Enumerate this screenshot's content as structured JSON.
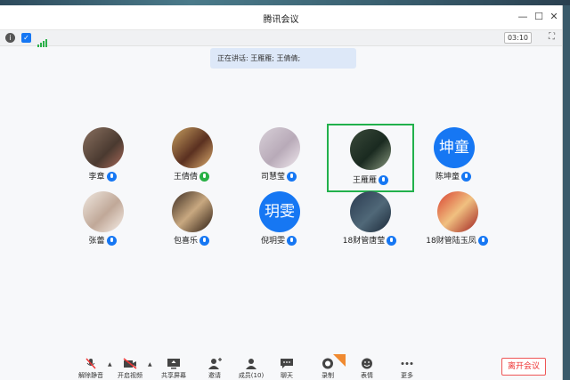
{
  "window": {
    "title": "腾讯会议"
  },
  "status": {
    "timer": "03:10"
  },
  "speaking": {
    "text": "正在讲话: 王雁雁; 王倩倩;"
  },
  "participants": [
    {
      "name": "李章"
    },
    {
      "name": "王倩倩"
    },
    {
      "name": "司慧莹"
    },
    {
      "name": "王雁雁"
    },
    {
      "name": "陈坤童",
      "avatar_text": "坤童"
    },
    {
      "name": "张蕾"
    },
    {
      "name": "包喜乐"
    },
    {
      "name": "倪玥雯",
      "avatar_text": "玥雯"
    },
    {
      "name": "18财管唐莹"
    },
    {
      "name": "18财管陆玉凤"
    }
  ],
  "toolbar": {
    "unmute": "解除静音",
    "video": "开启视频",
    "share": "共享屏幕",
    "invite": "邀请",
    "members": "成员(10)",
    "chat": "聊天",
    "record": "录制",
    "emoji": "表情",
    "more": "更多",
    "leave": "离开会议"
  },
  "colors": {
    "accent": "#1677f3",
    "active_border": "#22b14c",
    "leave": "#e33333"
  }
}
